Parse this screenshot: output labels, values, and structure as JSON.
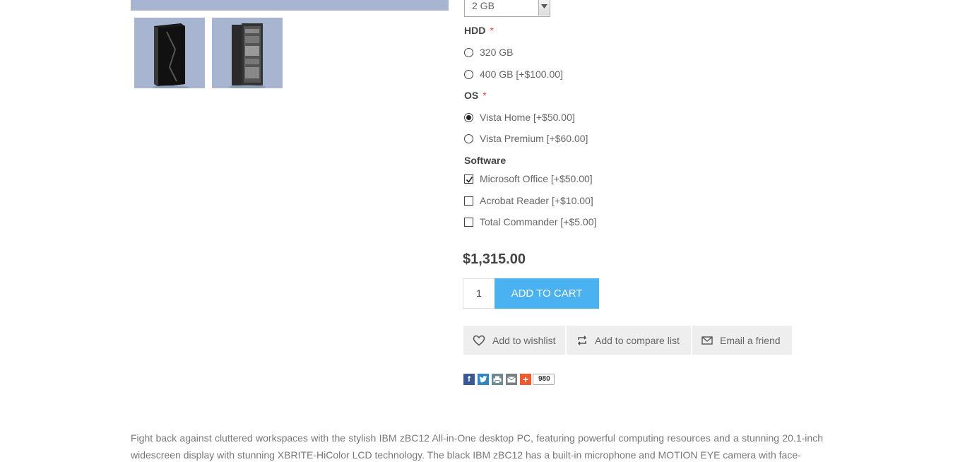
{
  "options": {
    "ram_selected": "2 GB",
    "hdd": {
      "title": "HDD",
      "required_mark": "*",
      "choices": [
        {
          "label": "320 GB",
          "selected": false
        },
        {
          "label": "400 GB [+$100.00]",
          "selected": false
        }
      ]
    },
    "os": {
      "title": "OS",
      "required_mark": "*",
      "choices": [
        {
          "label": "Vista Home [+$50.00]",
          "selected": true
        },
        {
          "label": "Vista Premium [+$60.00]",
          "selected": false
        }
      ]
    },
    "software": {
      "title": "Software",
      "choices": [
        {
          "label": "Microsoft Office [+$50.00]",
          "checked": true
        },
        {
          "label": "Acrobat Reader [+$10.00]",
          "checked": false
        },
        {
          "label": "Total Commander [+$5.00]",
          "checked": false
        }
      ]
    }
  },
  "price": "$1,315.00",
  "quantity": "1",
  "add_to_cart": "ADD TO CART",
  "actions": {
    "wishlist": "Add to wishlist",
    "compare": "Add to compare list",
    "email": "Email a friend"
  },
  "share": {
    "count": "980"
  },
  "description": "Fight back against cluttered workspaces with the stylish IBM zBC12 All-in-One desktop PC, featuring powerful computing resources and a stunning 20.1-inch widescreen display with stunning XBRITE-HiColor LCD technology. The black IBM zBC12 has a built-in microphone and MOTION EYE camera with face-",
  "colors": {
    "accent": "#4ab2f1",
    "required": "#e4444b",
    "image_bg": "#a7b5d1",
    "action_bg": "#eeeeee"
  }
}
